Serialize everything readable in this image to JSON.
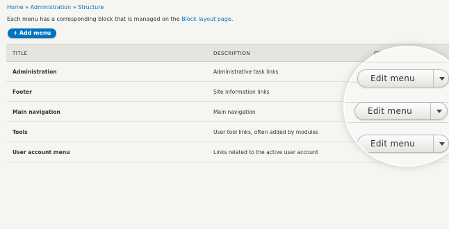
{
  "breadcrumb": {
    "home": "Home",
    "sep1": " » ",
    "administration": "Administration",
    "sep2": " » ",
    "structure": "Structure"
  },
  "intro": {
    "text_before": "Each menu has a corresponding block that is managed on the ",
    "link": "Block layout page",
    "text_after": "."
  },
  "add_button": {
    "plus": "+",
    "label": "Add menu"
  },
  "table": {
    "headers": {
      "title": "TITLE",
      "description": "DESCRIPTION",
      "operations": "OPERATIONS"
    },
    "rows": [
      {
        "title": "Administration",
        "description": "Administrative task links"
      },
      {
        "title": "Footer",
        "description": "Site information links"
      },
      {
        "title": "Main navigation",
        "description": "Main navigation"
      },
      {
        "title": "Tools",
        "description": "User tool links, often added by modules"
      },
      {
        "title": "User account menu",
        "description": "Links related to the active user account"
      }
    ]
  },
  "operations": {
    "edit_label": "Edit menu"
  },
  "colors": {
    "link": "#0074bd",
    "primary_button": "#0074bd",
    "header_bg": "#e6e4df"
  }
}
